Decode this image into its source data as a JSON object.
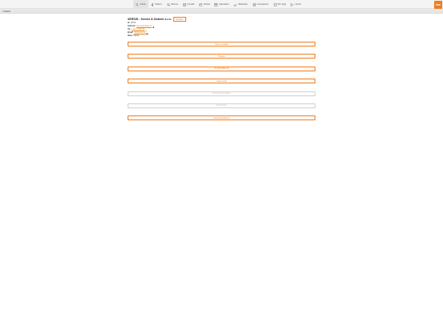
{
  "nav": {
    "items": [
      {
        "label": "Clienti",
        "icon": "search-icon",
        "active": true
      },
      {
        "label": "Indietro",
        "icon": "back-chevron-icon",
        "active": false
      },
      {
        "label": "Ricerca",
        "icon": "magnifier-icon",
        "active": false
      },
      {
        "label": "Contatti",
        "icon": "contacts-icon",
        "active": false
      },
      {
        "label": "Attività",
        "icon": "activity-icon",
        "active": false
      },
      {
        "label": "Calendario",
        "icon": "calendar-icon",
        "active": false
      },
      {
        "label": "Statistiche",
        "icon": "chart-icon",
        "active": false
      },
      {
        "label": "Impostazioni",
        "icon": "settings-icon",
        "active": false
      },
      {
        "label": "Per Oggi",
        "icon": "today-icon",
        "active": false
      },
      {
        "label": "Uscire",
        "icon": "logout-icon",
        "active": false
      }
    ],
    "logo_text": "bas"
  },
  "subbar": {
    "back_label": "Indietro"
  },
  "client": {
    "name": "SERSIS - Servizi & Sistemi s.r.o.",
    "edit_label": "Modifica",
    "fields": {
      "id_label": "Id:",
      "id_value": "12753",
      "address_label": "Indirizzo:",
      "address_value": "Via Giulio Natta 14",
      "phone_label": "Tel.:",
      "phone_value": "+421 2 555 555",
      "email_label": "Email:",
      "email_value": "info@sersis.sk",
      "status_label": "Stato:",
      "status_value": "Cliente"
    }
  },
  "actions": [
    {
      "label": "Nuovo contatto",
      "disabled": false
    },
    {
      "label": "Progetti",
      "disabled": false
    },
    {
      "label": "Contratti Bianchi",
      "disabled": false
    },
    {
      "label": "Opportunità",
      "disabled": false
    },
    {
      "label": "Documenti Fornitore",
      "disabled": true
    },
    {
      "label": "Promozioni",
      "disabled": true
    },
    {
      "label": "Attività Spedizione",
      "disabled": false
    }
  ],
  "colors": {
    "accent": "#f07c1e",
    "disabled": "#b9b9b9"
  }
}
